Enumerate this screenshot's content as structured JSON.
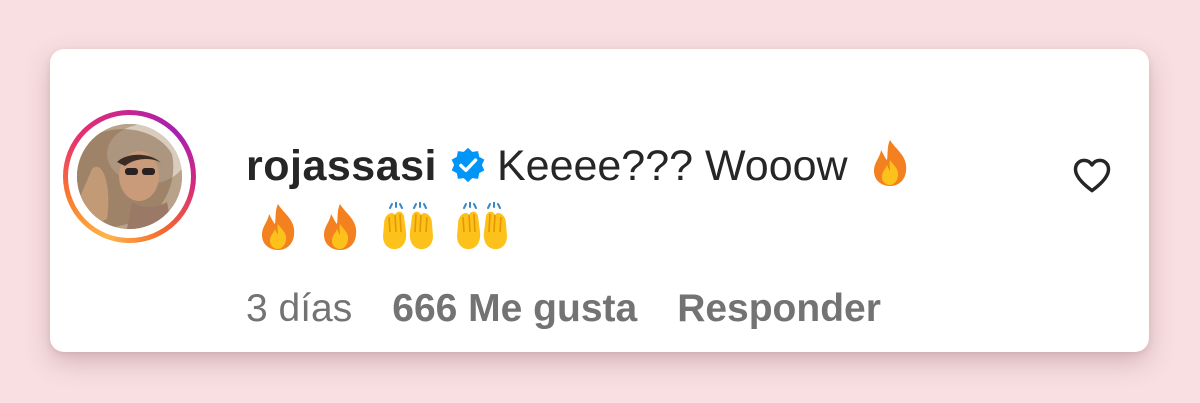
{
  "comment": {
    "username": "rojassasi",
    "verified": true,
    "text": "Keeee??? Wooow",
    "emojis_inline": [
      "fire-emoji"
    ],
    "emojis_row2": [
      "fire-emoji",
      "fire-emoji",
      "raising-hands-emoji",
      "raising-hands-emoji"
    ]
  },
  "meta": {
    "time": "3 días",
    "likes": "666 Me gusta",
    "reply": "Responder"
  },
  "icons": {
    "like": "heart-outline-icon",
    "verified": "verified-badge-icon"
  },
  "colors": {
    "background": "#f9dfe1",
    "card": "#ffffff",
    "text": "#262626",
    "secondary_text": "#737373",
    "verified_blue": "#0095f6"
  }
}
